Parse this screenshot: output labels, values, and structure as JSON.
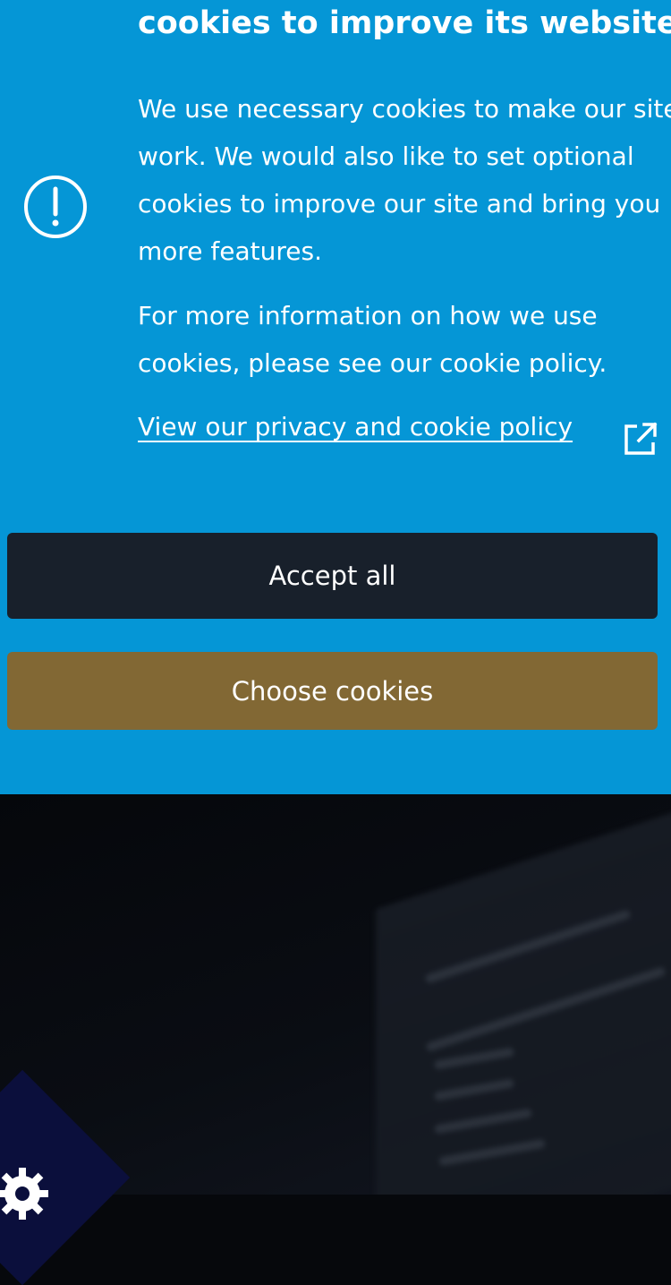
{
  "banner": {
    "heading": "cookies to improve its website.",
    "paragraphs": [
      "We use necessary cookies to make our site work. We would also like to set optional cookies to improve our site and bring you more features.",
      "For more information on how we use cookies, please see our cookie policy."
    ],
    "policy_link": "View our privacy and cookie policy",
    "icons": {
      "alert": "exclamation-circle-icon",
      "external": "external-link-icon"
    }
  },
  "buttons": {
    "accept_label": "Accept all",
    "choose_label": "Choose cookies"
  },
  "colors": {
    "banner_bg": "#0596d6",
    "accept_bg": "#18202b",
    "choose_bg": "#826834",
    "text": "#ffffff"
  },
  "corner_badge": {
    "icon": "gear-icon"
  }
}
